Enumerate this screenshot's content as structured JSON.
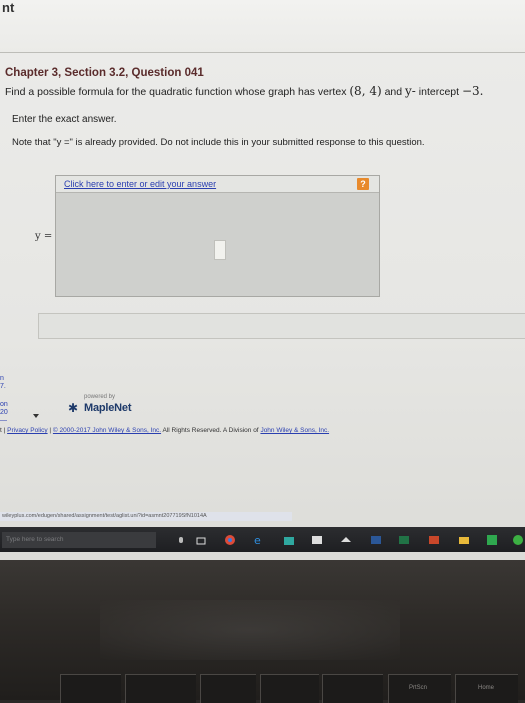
{
  "browser": {
    "tab_fragment": "nt",
    "url": "wileyplus.com/edugen/shared/assignment/test/aglist.uni?id=asmnt207719SfN1014A"
  },
  "question": {
    "title": "Chapter 3, Section 3.2, Question 041",
    "prompt_prefix": "Find a possible formula for the quadratic function whose graph has vertex",
    "vertex": "(8, 4)",
    "prompt_mid": "and",
    "y_var": "y-",
    "prompt_intercept": "intercept",
    "intercept_value": "−3.",
    "enter_exact": "Enter the exact answer.",
    "note": "Note that \"y =\" is already provided. Do not include this in your submitted response to this question."
  },
  "answer": {
    "edit_link": "Click here to enter or edit your answer",
    "help_icon": "?",
    "y_label": "y =",
    "input_value": ""
  },
  "left_edge": {
    "line1": "n",
    "line2": "7.",
    "line3": "on",
    "line4": "20",
    "line5": "—"
  },
  "branding": {
    "powered_by": "powered by",
    "name": "MapleNet"
  },
  "footer": {
    "prefix": "t |",
    "privacy": "Privacy Policy",
    "sep": "|",
    "copyright": "© 2000-2017 John Wiley & Sons, Inc.",
    "rights": "All Rights Reserved. A Division of",
    "company": "John Wiley & Sons, Inc."
  },
  "taskbar": {
    "search_placeholder": "Type here to search"
  },
  "keyboard": {
    "prtscn": "PrtScn",
    "home": "Home"
  },
  "colors": {
    "title": "#5a2b2b",
    "link": "#2a3fb0",
    "help_accent": "#e88a2c",
    "answer_bg": "#cfd0cd"
  }
}
